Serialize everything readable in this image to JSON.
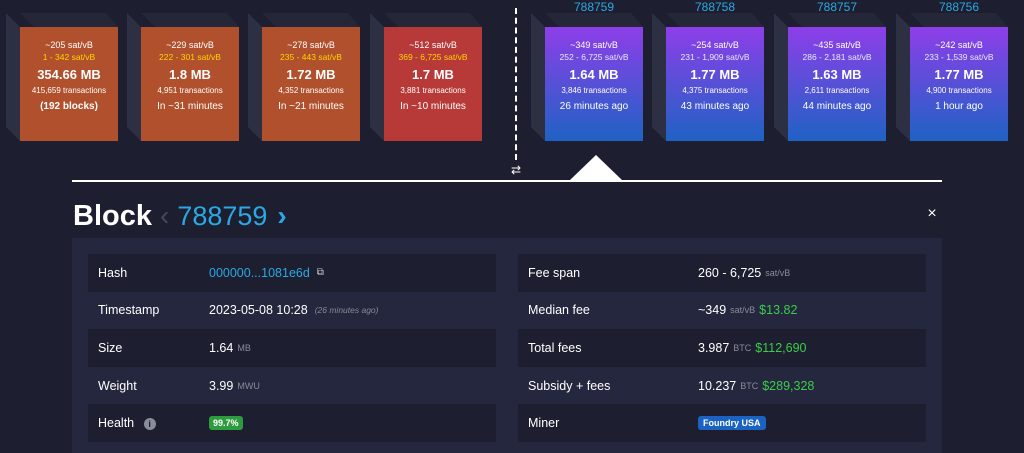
{
  "mempool_blocks": [
    {
      "fee": "~205 sat/vB",
      "range": "1 - 342 sat/vB",
      "size": "354.66 MB",
      "tx": "415,659 transactions",
      "time": "(192 blocks)"
    },
    {
      "fee": "~229 sat/vB",
      "range": "222 - 301 sat/vB",
      "size": "1.8 MB",
      "tx": "4,951 transactions",
      "time": "In ~31 minutes"
    },
    {
      "fee": "~278 sat/vB",
      "range": "235 - 443 sat/vB",
      "size": "1.72 MB",
      "tx": "4,352 transactions",
      "time": "In ~21 minutes"
    },
    {
      "fee": "~512 sat/vB",
      "range": "369 - 6,725 sat/vB",
      "size": "1.7 MB",
      "tx": "3,881 transactions",
      "time": "In ~10 minutes"
    }
  ],
  "mined_blocks": [
    {
      "height": "788759",
      "fee": "~349 sat/vB",
      "range": "252 - 6,725 sat/vB",
      "size": "1.64 MB",
      "tx": "3,846 transactions",
      "time": "26 minutes ago"
    },
    {
      "height": "788758",
      "fee": "~254 sat/vB",
      "range": "231 - 1,909 sat/vB",
      "size": "1.77 MB",
      "tx": "4,375 transactions",
      "time": "43 minutes ago"
    },
    {
      "height": "788757",
      "fee": "~435 sat/vB",
      "range": "286 - 2,181 sat/vB",
      "size": "1.63 MB",
      "tx": "2,611 transactions",
      "time": "44 minutes ago"
    },
    {
      "height": "788756",
      "fee": "~242 sat/vB",
      "range": "233 - 1,539 sat/vB",
      "size": "1.77 MB",
      "tx": "4,900 transactions",
      "time": "1 hour ago"
    }
  ],
  "swap_icon": "⇄",
  "block": {
    "title": "Block",
    "prev_icon": "‹",
    "height": "788759",
    "next_icon": "›",
    "close_icon": "×",
    "hash_label": "Hash",
    "hash_value": "000000...1081e6d",
    "copy_icon": "⧉",
    "timestamp_label": "Timestamp",
    "timestamp_value": "2023-05-08 10:28",
    "timestamp_relative": "(26 minutes ago)",
    "size_label": "Size",
    "size_value": "1.64",
    "size_unit": "MB",
    "weight_label": "Weight",
    "weight_value": "3.99",
    "weight_unit": "MWU",
    "health_label": "Health",
    "health_info_icon": "i",
    "health_value": "99.7%",
    "fee_span_label": "Fee span",
    "fee_span_value": "260 - 6,725",
    "fee_span_unit": "sat/vB",
    "median_fee_label": "Median fee",
    "median_fee_value": "~349",
    "median_fee_unit": "sat/vB",
    "median_fee_usd": "$13.82",
    "total_fees_label": "Total fees",
    "total_fees_value": "3.987",
    "total_fees_unit": "BTC",
    "total_fees_usd": "$112,690",
    "subsidy_label": "Subsidy + fees",
    "subsidy_value": "10.237",
    "subsidy_unit": "BTC",
    "subsidy_usd": "$289,328",
    "miner_label": "Miner",
    "miner_value": "Foundry USA"
  }
}
